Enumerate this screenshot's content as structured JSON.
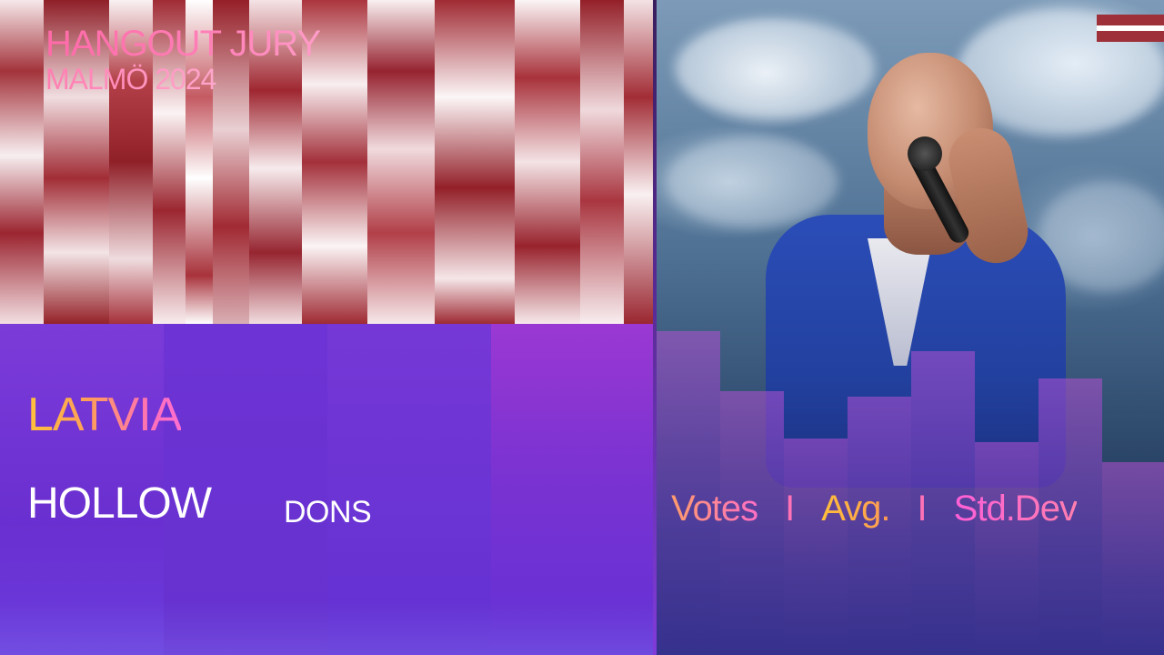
{
  "brand": {
    "title": "HANGOUT JURY",
    "subtitle": "MALMÖ 2024"
  },
  "entry": {
    "country": "LATVIA",
    "song": "HOLLOW",
    "artist": "DONS"
  },
  "stats": {
    "votes": "Votes",
    "separator_1": "I",
    "average": "Avg.",
    "separator_2": "I",
    "std_dev": "Std.Dev"
  },
  "flag": {
    "country": "Latvia",
    "colors": {
      "carmine": "#9e3039",
      "white": "#ffffff"
    }
  },
  "colors": {
    "panel_purple": "#6a2fd6",
    "stripe_red": "#9c2730",
    "accent_pink": "#ff6fc4",
    "accent_gold": "#ffbf3a"
  }
}
